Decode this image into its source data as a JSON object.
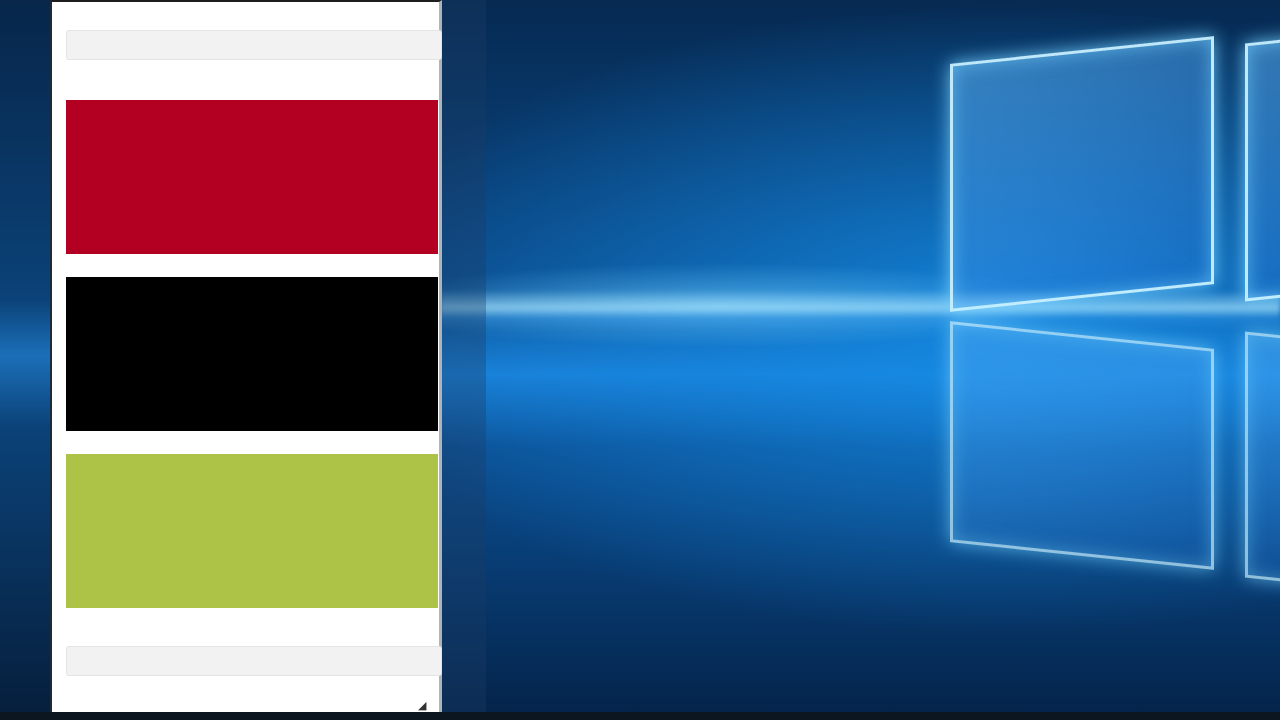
{
  "desktop": {
    "wallpaper": "windows-10-hero-light",
    "accent": "#1a7fd6"
  },
  "window": {
    "top_field": {
      "value": ""
    },
    "swatches": [
      {
        "name": "red",
        "color": "#b30022"
      },
      {
        "name": "black",
        "color": "#000000"
      },
      {
        "name": "lime",
        "color": "#adc347"
      }
    ],
    "bottom_field": {
      "value": ""
    },
    "resize_grip_icon": "resize-grip-icon"
  }
}
